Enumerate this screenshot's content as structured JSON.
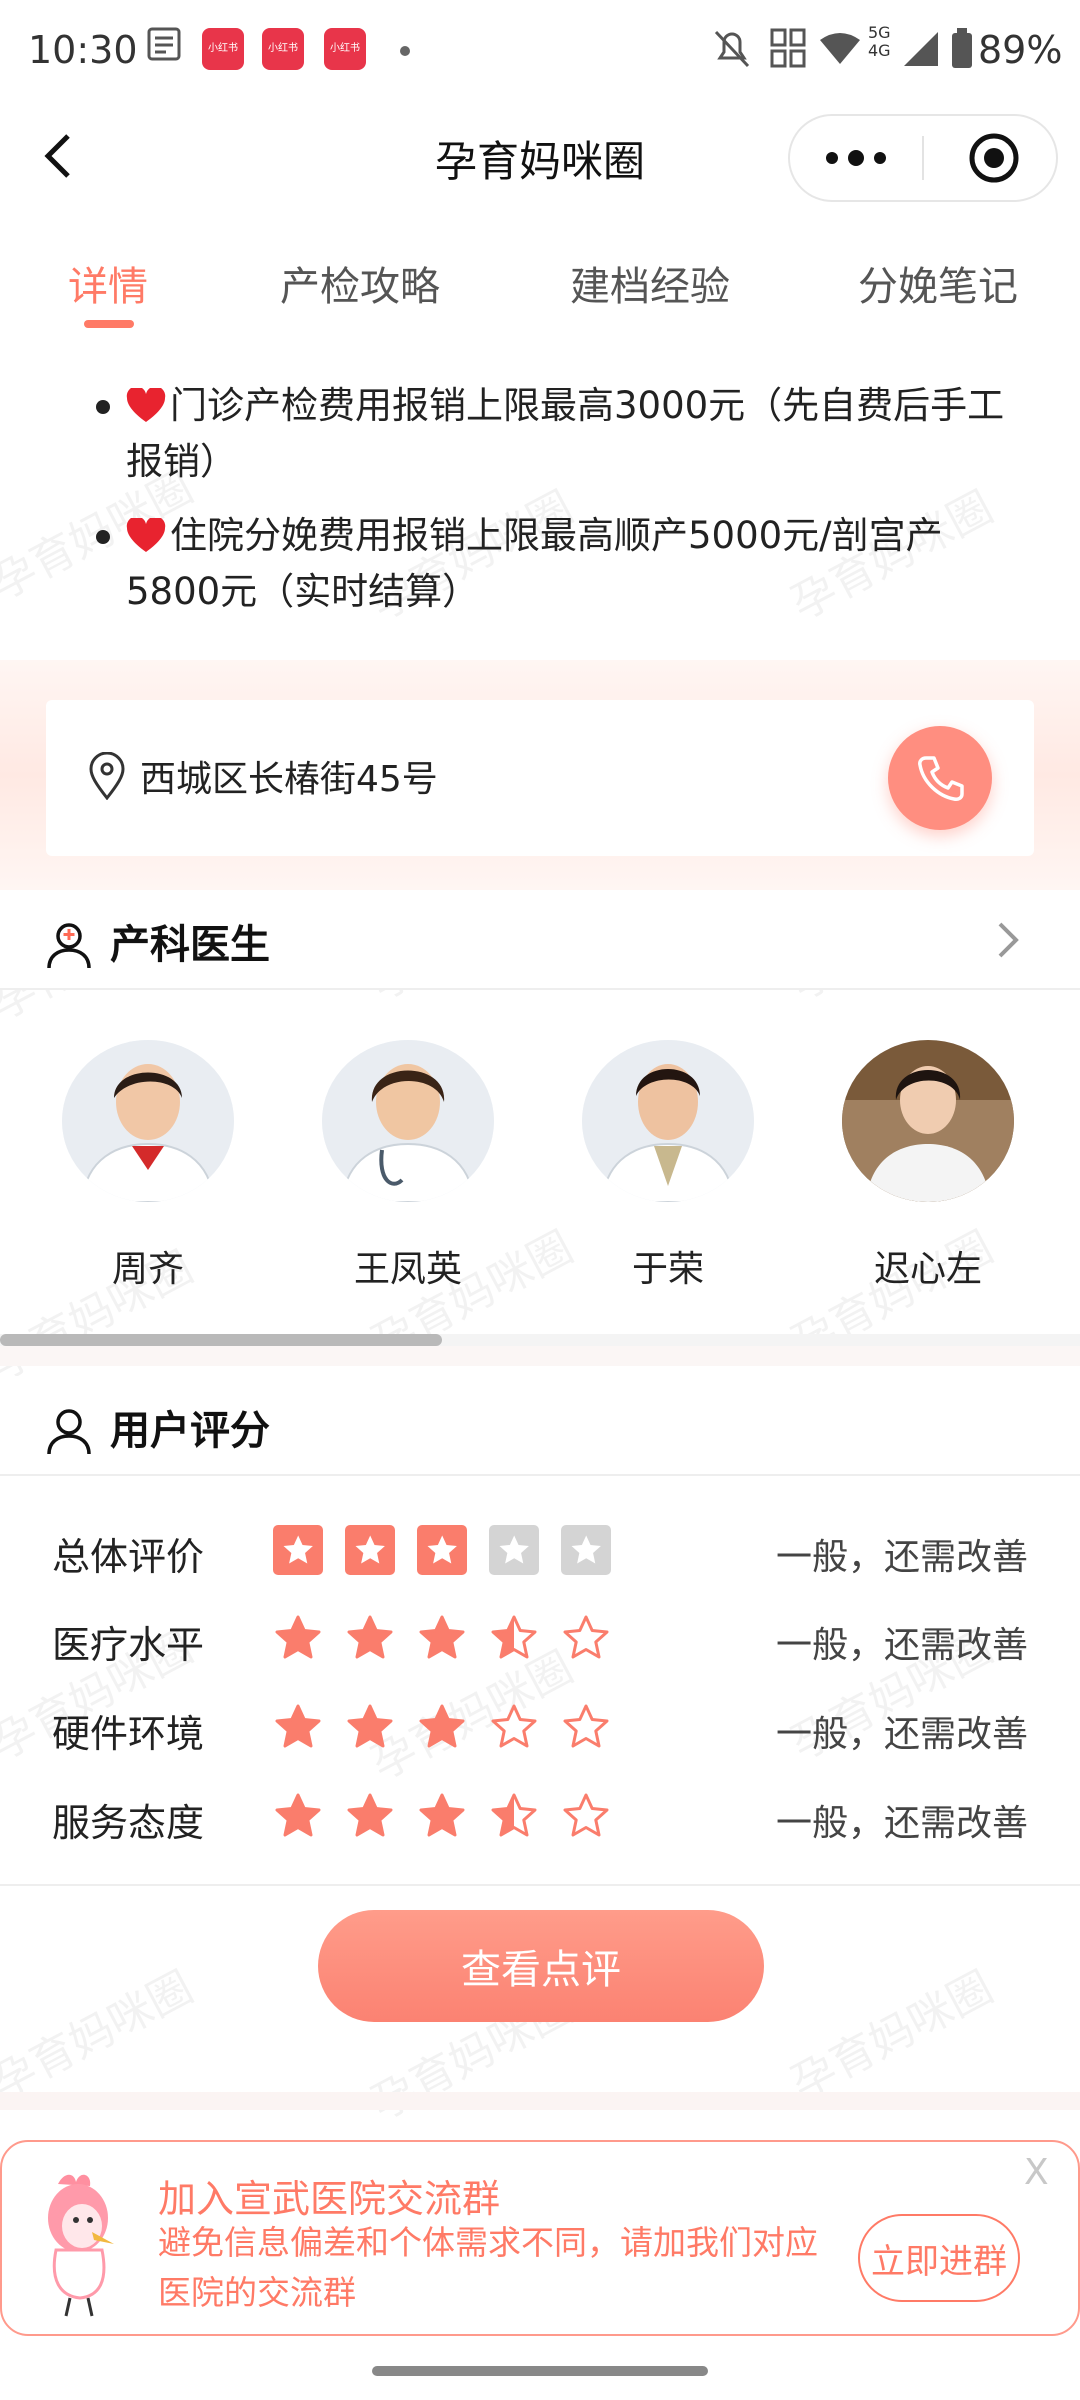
{
  "status_bar": {
    "time": "10:30",
    "notif_badge_label": "小红书",
    "network": "5G 4G",
    "battery": "89%"
  },
  "nav": {
    "title": "孕育妈咪圈"
  },
  "tabs": [
    {
      "label": "详情",
      "active": true
    },
    {
      "label": "产检攻略",
      "active": false
    },
    {
      "label": "建档经验",
      "active": false
    },
    {
      "label": "分娩笔记",
      "active": false
    }
  ],
  "benefits": [
    "门诊产检费用报销上限最高3000元（先自费后手工报销）",
    "住院分娩费用报销上限最高顺产5000元/剖宫产5800元（实时结算）"
  ],
  "address": {
    "text": "西城区长椿街45号"
  },
  "doctors_section": {
    "title": "产科医生",
    "doctors": [
      {
        "name": "周齐"
      },
      {
        "name": "王凤英"
      },
      {
        "name": "于荣"
      },
      {
        "name": "迟心左"
      }
    ]
  },
  "ratings_section": {
    "title": "用户评分",
    "rows": [
      {
        "label": "总体评价",
        "stars": 3,
        "desc": "一般，还需改善",
        "style": "boxed"
      },
      {
        "label": "医疗水平",
        "stars": 3.5,
        "desc": "一般，还需改善",
        "style": "plain"
      },
      {
        "label": "硬件环境",
        "stars": 3,
        "desc": "一般，还需改善",
        "style": "plain"
      },
      {
        "label": "服务态度",
        "stars": 3.5,
        "desc": "一般，还需改善",
        "style": "plain"
      }
    ],
    "button": "查看点评"
  },
  "join_banner": {
    "title": "加入宣武医院交流群",
    "desc": "避免信息偏差和个体需求不同，请加我们对应医院的交流群",
    "button": "立即进群",
    "close": "X"
  },
  "watermark": "孕育妈咪圈",
  "colors": {
    "accent": "#ff7a66",
    "star": "#fa7d6c",
    "star_empty": "#fa7d6c"
  }
}
